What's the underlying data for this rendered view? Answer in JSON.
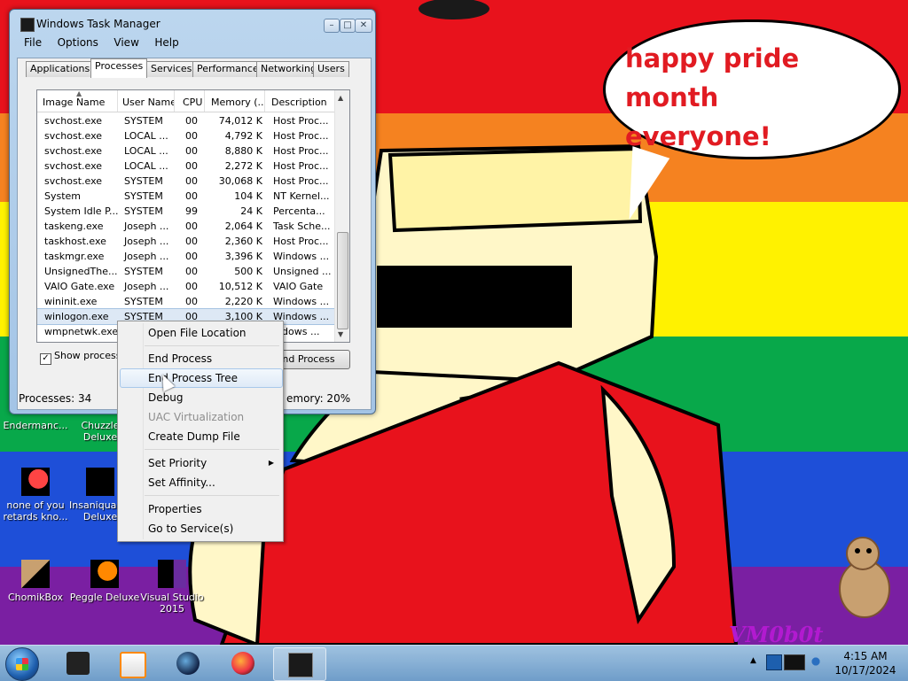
{
  "speech_bubble": {
    "line1": "happy pride month",
    "line2": "everyone!"
  },
  "watermark": "VM0b0t",
  "desktop_icons": [
    {
      "label": "Endermanc..."
    },
    {
      "label": "Chuzzle Deluxe"
    },
    {
      "label": "none of you retards kno..."
    },
    {
      "label": "Insaniquarium Deluxe"
    },
    {
      "label": "ChomikBox"
    },
    {
      "label": "Peggle Deluxe"
    },
    {
      "label": "Visual Studio 2015"
    }
  ],
  "window": {
    "title": "Windows Task Manager",
    "minimize_glyph": "–",
    "maximize_glyph": "□",
    "close_glyph": "✕",
    "menu": [
      "File",
      "Options",
      "View",
      "Help"
    ],
    "tabs": [
      "Applications",
      "Processes",
      "Services",
      "Performance",
      "Networking",
      "Users"
    ],
    "active_tab": "Processes",
    "columns": [
      "Image Name",
      "User Name",
      "CPU",
      "Memory (...",
      "Description"
    ],
    "processes": [
      {
        "name": "svchost.exe",
        "user": "SYSTEM",
        "cpu": "00",
        "mem": "74,012 K",
        "desc": "Host Proc..."
      },
      {
        "name": "svchost.exe",
        "user": "LOCAL ...",
        "cpu": "00",
        "mem": "4,792 K",
        "desc": "Host Proc..."
      },
      {
        "name": "svchost.exe",
        "user": "LOCAL ...",
        "cpu": "00",
        "mem": "8,880 K",
        "desc": "Host Proc..."
      },
      {
        "name": "svchost.exe",
        "user": "LOCAL ...",
        "cpu": "00",
        "mem": "2,272 K",
        "desc": "Host Proc..."
      },
      {
        "name": "svchost.exe",
        "user": "SYSTEM",
        "cpu": "00",
        "mem": "30,068 K",
        "desc": "Host Proc..."
      },
      {
        "name": "System",
        "user": "SYSTEM",
        "cpu": "00",
        "mem": "104 K",
        "desc": "NT Kernel..."
      },
      {
        "name": "System Idle P...",
        "user": "SYSTEM",
        "cpu": "99",
        "mem": "24 K",
        "desc": "Percenta..."
      },
      {
        "name": "taskeng.exe",
        "user": "Joseph ...",
        "cpu": "00",
        "mem": "2,064 K",
        "desc": "Task Sche..."
      },
      {
        "name": "taskhost.exe",
        "user": "Joseph ...",
        "cpu": "00",
        "mem": "2,360 K",
        "desc": "Host Proc..."
      },
      {
        "name": "taskmgr.exe",
        "user": "Joseph ...",
        "cpu": "00",
        "mem": "3,396 K",
        "desc": "Windows ..."
      },
      {
        "name": "UnsignedThe...",
        "user": "SYSTEM",
        "cpu": "00",
        "mem": "500 K",
        "desc": "Unsigned ..."
      },
      {
        "name": "VAIO Gate.exe",
        "user": "Joseph ...",
        "cpu": "00",
        "mem": "10,512 K",
        "desc": "VAIO Gate"
      },
      {
        "name": "wininit.exe",
        "user": "SYSTEM",
        "cpu": "00",
        "mem": "2,220 K",
        "desc": "Windows ..."
      },
      {
        "name": "winlogon.exe",
        "user": "SYSTEM",
        "cpu": "00",
        "mem": "3,100 K",
        "desc": "Windows ..."
      },
      {
        "name": "wmpnetwk.exe",
        "user": "",
        "cpu": "",
        "mem": "",
        "desc": "indows ..."
      }
    ],
    "selected_process": "winlogon.exe",
    "show_processes_label": "Show processe",
    "show_processes_checked": "✓",
    "end_process_button": "nd Process",
    "status_processes": "Processes: 34",
    "status_cpu_fragment": "C",
    "status_memory": "emory: 20%"
  },
  "context_menu": {
    "items": [
      {
        "label": "Open File Location",
        "state": "normal"
      },
      {
        "label": "End Process",
        "state": "normal"
      },
      {
        "label": "End Process Tree",
        "state": "hover"
      },
      {
        "label": "Debug",
        "state": "normal"
      },
      {
        "label": "UAC Virtualization",
        "state": "disabled"
      },
      {
        "label": "Create Dump File",
        "state": "normal"
      },
      {
        "label": "Set Priority",
        "state": "normal",
        "submenu_glyph": "▶"
      },
      {
        "label": "Set Affinity...",
        "state": "normal"
      },
      {
        "label": "Properties",
        "state": "normal"
      },
      {
        "label": "Go to Service(s)",
        "state": "normal"
      }
    ]
  },
  "taskbar": {
    "pinned_icons": [
      "folder-icon",
      "media-player-icon",
      "globe-icon",
      "firefox-icon",
      "task-manager-icon"
    ],
    "tray_arrow": "▲",
    "tray_icons": [
      "network-icon",
      "monitor-icon",
      "volume-icon"
    ],
    "clock_time": "4:15 AM",
    "clock_date": "10/17/2024"
  },
  "colors": {
    "rainbow": [
      "#e8121c",
      "#f58220",
      "#fff200",
      "#f7ec13",
      "#08a84a",
      "#1e4fd8",
      "#7a1fa2"
    ],
    "speech_text": "#e11b22",
    "watermark": "#b21ad0"
  }
}
